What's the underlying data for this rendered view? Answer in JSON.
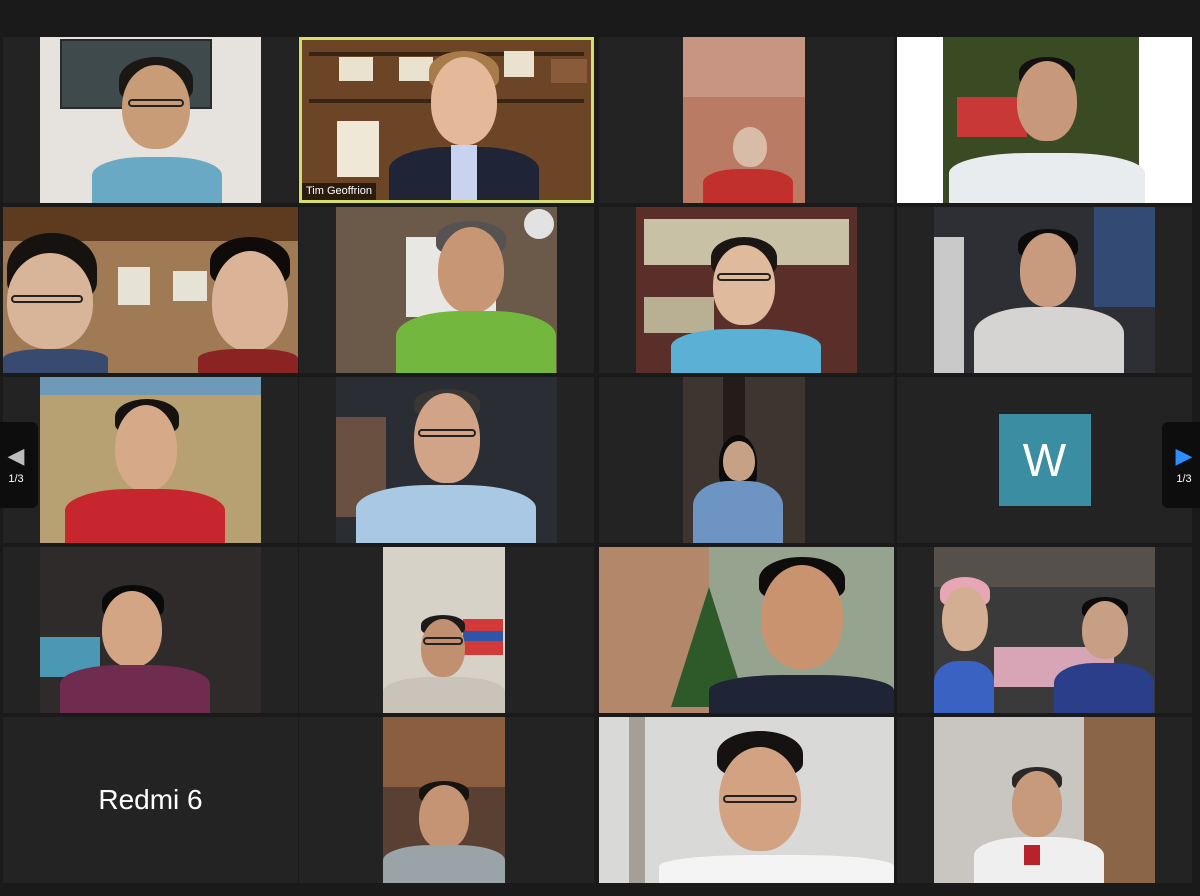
{
  "meeting": {
    "active_speaker": "Tim Geoffrion",
    "pagination": {
      "left_page": "1/3",
      "right_page": "1/3"
    }
  },
  "colors": {
    "background": "#1a1a1a",
    "active_speaker_border": "#d4de6a",
    "avatar_w_bg": "#3b8da1",
    "nav_right_arrow": "#2d8cff"
  },
  "participants": {
    "tile_r1c2_name": "Tim Geoffrion",
    "tile_r3c4_avatar_letter": "W",
    "tile_r5c1_name": "Redmi 6"
  },
  "icons": {
    "left_arrow": "◀",
    "right_arrow": "▶"
  }
}
